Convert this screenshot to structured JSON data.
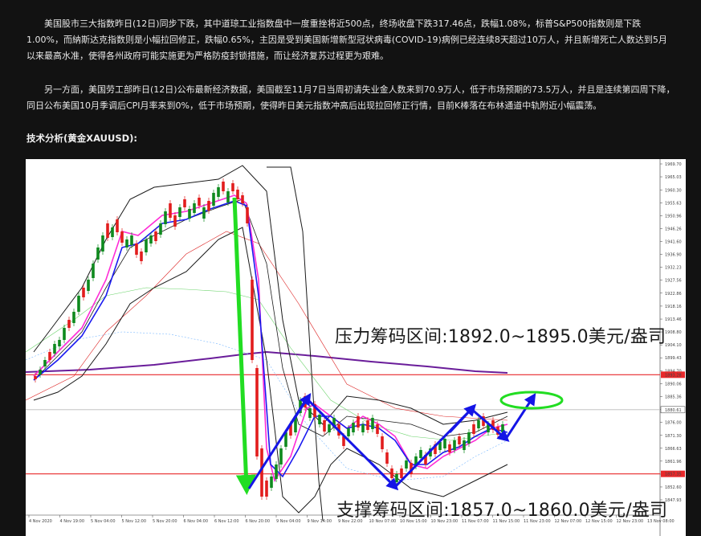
{
  "article": {
    "paragraph_1": "美国股市三大指数昨日(12日)同步下跌，其中道琼工业指数盘中一度重挫将近500点，终场收盘下跌317.46点，跌幅1.08%，标普S&P500指数则是下跌1.00%，而納斯达克指数则是小幅拉回修正，跌幅0.65%，主因是受到美国新增新型冠状病毒(COVID-19)病例已经连续8天超过10万人，并且新增死亡人数达到5月以来最高水准，使得各州政府可能实施更为严格防疫封锁措施，而让经济复苏过程更为艰难。",
    "paragraph_2": "另一方面，美国劳工部昨日(12日)公布最新经济数据，美国截至11月7日当周初请失业金人数来到70.9万人，低于市场预期的73.5万人，并且是连续第四周下降，同日公布美国10月季调后CPI月率来到0%，低于市场预期，使得昨日美元指数冲高后出现拉回修正行情，目前K棒落在布林通道中轨附近小幅震荡。",
    "section_heading": "技术分析(黄金XAUUSD):"
  },
  "chart": {
    "resistance_label": "压力筹码区间:1892.0~1895.0美元/盎司",
    "support_label": "支撑筹码区间:1857.0~1860.0美元/盎司",
    "colors": {
      "resistance_line": "#e8282a",
      "support_line": "#e8282a",
      "crash_arrow": "#22dd22",
      "pattern_arrow": "#1515e6",
      "target_ellipse": "#22dd22",
      "ma_long": "#6a1d9a",
      "bollinger": "#1a1a1a",
      "ma_fast": "#ff2bd6",
      "ma_mid": "#1a1af0",
      "candle_up": "#0e8a1e",
      "candle_down": "#e21d1d"
    },
    "price_scale": [
      "1969.70",
      "1965.03",
      "1960.30",
      "1955.63",
      "1950.96",
      "1946.26",
      "1941.60",
      "1936.90",
      "1932.23",
      "1927.56",
      "1922.86",
      "1918.16",
      "1913.46",
      "1908.80",
      "1904.10",
      "1899.43",
      "1894.70",
      "1890.06",
      "1885.36",
      "1880.70",
      "1876.00",
      "1871.30",
      "1866.63",
      "1861.96",
      "1857.26",
      "1852.60",
      "1847.93"
    ],
    "price_scale_marks": [
      "1893.28",
      "1880.61",
      "1857.35"
    ],
    "time_scale": [
      "4 Nov 2020",
      "4 Nov 19:00",
      "5 Nov 04:00",
      "5 Nov 12:00",
      "5 Nov 20:00",
      "6 Nov 04:00",
      "6 Nov 12:00",
      "6 Nov 20:00",
      "9 Nov 04:00",
      "9 Nov 14:00",
      "9 Nov 22:00",
      "10 Nov 07:00",
      "10 Nov 15:00",
      "10 Nov 23:00",
      "11 Nov 07:00",
      "11 Nov 15:00",
      "11 Nov 23:00",
      "12 Nov 07:00",
      "12 Nov 15:00",
      "12 Nov 23:00",
      "13 Nov 08:00"
    ]
  }
}
